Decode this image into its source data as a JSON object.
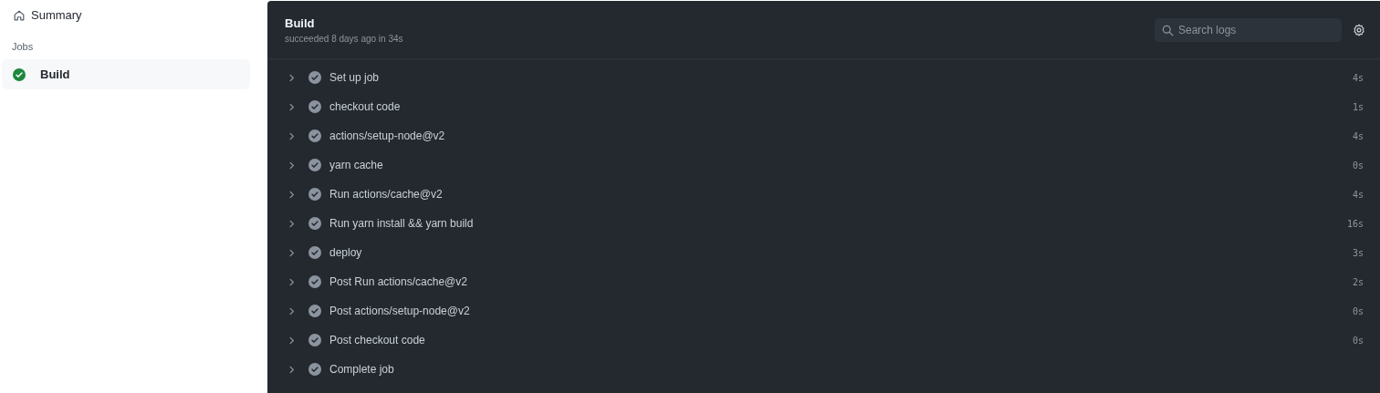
{
  "sidebar": {
    "summary": {
      "label": "Summary"
    },
    "jobs_heading": "Jobs",
    "jobs": [
      {
        "label": "Build",
        "kind": "success",
        "selected": true
      }
    ]
  },
  "job": {
    "title": "Build",
    "subtitle": "succeeded 8 days ago in 34s",
    "search": {
      "placeholder": "Search logs"
    },
    "steps": [
      {
        "name": "Set up job",
        "kind": "success",
        "expanded": false,
        "duration": "4s"
      },
      {
        "name": "checkout code",
        "kind": "success",
        "expanded": false,
        "duration": "1s"
      },
      {
        "name": "actions/setup-node@v2",
        "kind": "success",
        "expanded": false,
        "duration": "4s"
      },
      {
        "name": "yarn cache",
        "kind": "success",
        "expanded": false,
        "duration": "0s"
      },
      {
        "name": "Run actions/cache@v2",
        "kind": "success",
        "expanded": false,
        "duration": "4s"
      },
      {
        "name": "Run yarn install && yarn build",
        "kind": "success",
        "expanded": false,
        "duration": "16s"
      },
      {
        "name": "deploy",
        "kind": "success",
        "expanded": false,
        "duration": "3s"
      },
      {
        "name": "Post Run actions/cache@v2",
        "kind": "success",
        "expanded": false,
        "duration": "2s"
      },
      {
        "name": "Post actions/setup-node@v2",
        "kind": "success",
        "expanded": false,
        "duration": "0s"
      },
      {
        "name": "Post checkout code",
        "kind": "success",
        "expanded": false,
        "duration": "0s"
      },
      {
        "name": "Complete job",
        "kind": "success",
        "expanded": false
      }
    ]
  }
}
